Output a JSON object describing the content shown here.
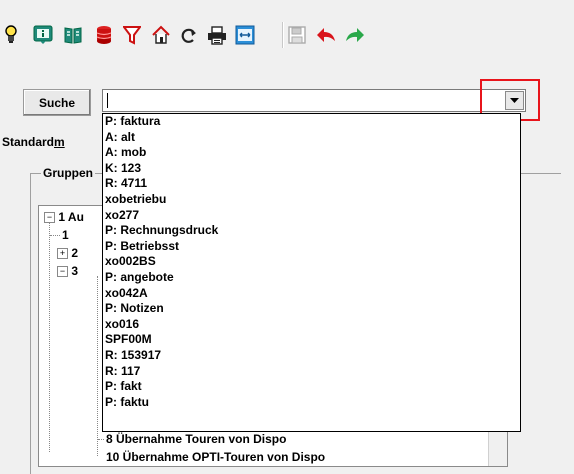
{
  "toolbar": {
    "icons": [
      "lightbulb-icon",
      "info-icon",
      "book-icon",
      "database-icon",
      "filter-icon",
      "home-icon",
      "refresh-icon",
      "print-icon",
      "expand-icon",
      "save-icon",
      "undo-icon",
      "redo-icon"
    ]
  },
  "search": {
    "button_label": "Suche",
    "value": ""
  },
  "dropdown": {
    "items": [
      "P: faktura",
      "A: alt",
      "A: mob",
      "K: 123",
      "R: 4711",
      "xobetriebu",
      "xo277",
      "P: Rechnungsdruck",
      "P: Betriebsst",
      "xo002BS",
      "P: angebote",
      "xo042A",
      "P: Notizen",
      "xo016",
      "SPF00M",
      "R: 153917",
      "R: 117",
      "P: fakt",
      "P: faktu"
    ]
  },
  "tabs": {
    "standard_prefix": "Standard",
    "standard_underlined": "m"
  },
  "groups": {
    "label": "Gruppen"
  },
  "tree": {
    "node1": "1 Au",
    "node1_1": "1",
    "node2": "2",
    "node3": "3",
    "node8": "8 Übernahme Touren von Dispo",
    "node10": "10 Übernahme OPTI-Touren von Dispo"
  },
  "colors": {
    "highlight": "#e8141b",
    "redo_green": "#2aa84a",
    "undo_red": "#d9141b"
  }
}
